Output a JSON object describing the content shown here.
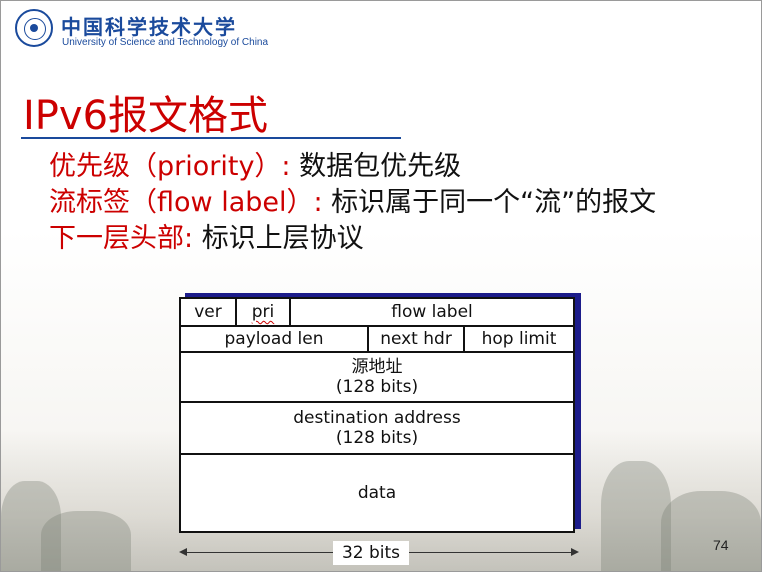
{
  "header": {
    "university_cn": "中国科学技术大学",
    "university_en": "University of Science and Technology of China"
  },
  "slide": {
    "title": "IPv6报文格式",
    "page_number": "74"
  },
  "bullets": [
    {
      "term": "优先级（priority）: ",
      "desc": "数据包优先级"
    },
    {
      "term": "流标签（flow label）: ",
      "desc": "标识属于同一个“流”的报文"
    },
    {
      "term": "下一层头部: ",
      "desc": "标识上层协议"
    }
  ],
  "header_table": {
    "row1": {
      "ver": "ver",
      "pri": "pri",
      "flow_label": "flow label"
    },
    "row2": {
      "payload_len": "payload len",
      "next_hdr": "next hdr",
      "hop_limit": "hop limit"
    },
    "src": {
      "name": "源地址",
      "size": "(128 bits)"
    },
    "dst": {
      "name": "destination address",
      "size": "(128 bits)"
    },
    "data": "data",
    "width_label": "32 bits"
  },
  "colors": {
    "accent_red": "#cc0000",
    "brand_blue": "#1a4a9c",
    "table_shadow": "#1c1c8a"
  }
}
